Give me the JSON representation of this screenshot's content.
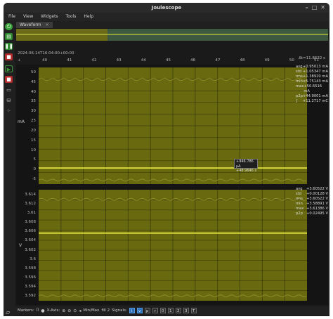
{
  "app": {
    "title": "Joulescope"
  },
  "window_buttons": [
    "–",
    "□",
    "✕"
  ],
  "menu": [
    "File",
    "View",
    "Widgets",
    "Tools",
    "Help"
  ],
  "tab": {
    "label": "Waveform",
    "close": "✕"
  },
  "timeline": {
    "timestamp": "2024-06-14T16:04:00+00:00",
    "dt": "Δt=11.8632 s",
    "ticks": [
      "+",
      "40",
      "41",
      "42",
      "43",
      "44",
      "45",
      "46",
      "47",
      "48",
      "49",
      "50",
      "51"
    ]
  },
  "current_plot": {
    "unit": "mA",
    "y_ticks": [
      "50",
      "45",
      "40",
      "35",
      "30",
      "25",
      "20",
      "15",
      "10",
      "5",
      "0",
      "-5"
    ],
    "stats": [
      {
        "name": "avg",
        "value": "+0.95013",
        "unit": "mA"
      },
      {
        "name": "std",
        "value": "+1.05347",
        "unit": "mA"
      },
      {
        "name": "rms",
        "value": "+1.38920",
        "unit": "mA"
      },
      {
        "name": "min",
        "value": "+5.75143",
        "unit": "mA"
      },
      {
        "name": "max",
        "value": "+50.6516",
        "unit": "mA"
      },
      {
        "name": "p2p",
        "value": "+44.9001",
        "unit": "mA"
      },
      {
        "name": "∫",
        "value": "+11.2717",
        "unit": "mC"
      }
    ],
    "marker_readout": [
      "+946.786 μA",
      "+48.9646 s"
    ],
    "chart_data": {
      "type": "line",
      "ylabel": "mA",
      "ylim": [
        -7,
        51
      ],
      "series": [
        {
          "values": [
            1,
            1,
            1,
            1,
            1,
            1,
            1,
            1,
            1,
            1,
            1,
            1
          ]
        }
      ],
      "noise_band_top": 45,
      "noise_band_bottom": -5
    }
  },
  "voltage_plot": {
    "unit": "V",
    "y_ticks": [
      "3.614",
      "3.612",
      "3.61",
      "3.608",
      "3.606",
      "3.604",
      "3.602",
      "3.6",
      "3.598",
      "3.596",
      "3.594",
      "3.592"
    ],
    "stats": [
      {
        "name": "avg",
        "value": "+3.60522",
        "unit": "V"
      },
      {
        "name": "std",
        "value": "+0.00128",
        "unit": "V"
      },
      {
        "name": "rms",
        "value": "+3.60522",
        "unit": "V"
      },
      {
        "name": "min",
        "value": "+3.58891",
        "unit": "V"
      },
      {
        "name": "max",
        "value": "+3.61386",
        "unit": "V"
      },
      {
        "name": "p2p",
        "value": "+0.02495",
        "unit": "V"
      }
    ],
    "chart_data": {
      "type": "line",
      "ylabel": "V",
      "ylim": [
        3.5915,
        3.6145
      ],
      "series": [
        {
          "values": [
            3.6055,
            3.6055,
            3.6055,
            3.6055,
            3.6055,
            3.6055,
            3.6055,
            3.6055
          ]
        }
      ],
      "noise_band_top": 3.6125,
      "noise_band_bottom": 3.5925
    }
  },
  "bottom_bar": {
    "markers_label": "Markers:",
    "xaxis_label": "X-Axis:",
    "minmax_label": "Min/Max",
    "fill_label": "fill 2",
    "signals_label": "Signals:",
    "signal_buttons": [
      "i",
      "v",
      "p",
      "r",
      "0",
      "1",
      "2",
      "3",
      "T"
    ]
  },
  "colors": {
    "plot_fill": "#696a10",
    "trace": "#d8d83a",
    "accent": "#2b6fb8"
  }
}
